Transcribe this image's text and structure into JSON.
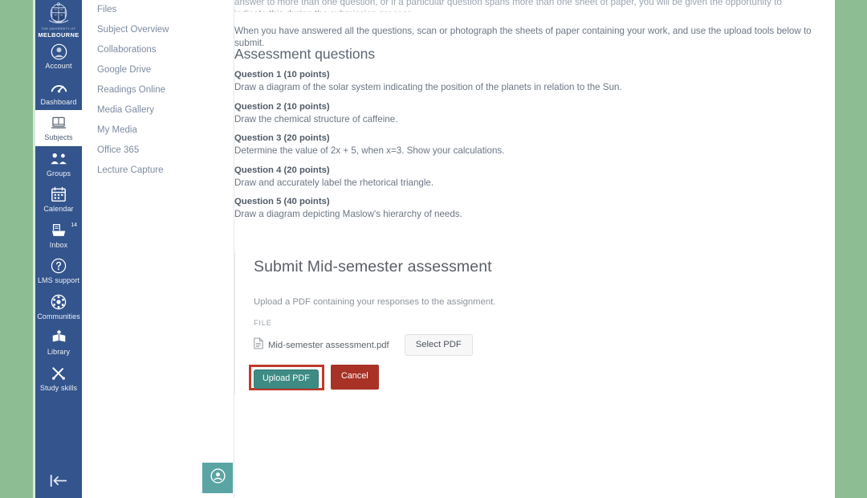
{
  "colors": {
    "page_band": "#8cbd93",
    "global_nav_bg": "#33548c",
    "accent_teal": "#3e8b84",
    "cancel_red": "#a93226",
    "highlight_red": "#c0392b",
    "fab_teal": "#5ba4a4"
  },
  "global_nav": {
    "logo": {
      "crest_icon": "university-crest-icon",
      "line1": "THE UNIVERSITY OF",
      "line2": "MELBOURNE"
    },
    "items": [
      {
        "label": "Account",
        "icon": "account-avatar-icon",
        "active": false,
        "badge": ""
      },
      {
        "label": "Dashboard",
        "icon": "dashboard-icon",
        "active": false,
        "badge": ""
      },
      {
        "label": "Subjects",
        "icon": "subjects-book-icon",
        "active": true,
        "badge": ""
      },
      {
        "label": "Groups",
        "icon": "groups-people-icon",
        "active": false,
        "badge": ""
      },
      {
        "label": "Calendar",
        "icon": "calendar-icon",
        "active": false,
        "badge": ""
      },
      {
        "label": "Inbox",
        "icon": "inbox-tray-icon",
        "active": false,
        "badge": "14"
      },
      {
        "label": "LMS support",
        "icon": "question-circle-icon",
        "active": false,
        "badge": ""
      },
      {
        "label": "Communities",
        "icon": "communities-globe-icon",
        "active": false,
        "badge": ""
      },
      {
        "label": "Library",
        "icon": "library-book-icon",
        "active": false,
        "badge": ""
      },
      {
        "label": "Study skills",
        "icon": "study-skills-icon",
        "active": false,
        "badge": ""
      }
    ],
    "collapse": {
      "icon": "collapse-left-arrow-icon",
      "label": ""
    }
  },
  "course_nav": {
    "items": [
      {
        "label": "Files"
      },
      {
        "label": "Subject Overview"
      },
      {
        "label": "Collaborations"
      },
      {
        "label": "Google Drive"
      },
      {
        "label": "Readings Online"
      },
      {
        "label": "Media Gallery"
      },
      {
        "label": "My Media"
      },
      {
        "label": "Office 365"
      },
      {
        "label": "Lecture Capture"
      }
    ],
    "help_fab": {
      "icon": "help-circle-icon"
    }
  },
  "content": {
    "intro_clipped": "answer to more than one question, or if a particular question spans more than one sheet of paper, you will be given the opportunity to indicate this during the submission process.",
    "paragraph_2": "When you have answered all the questions, scan or photograph the sheets of paper containing your work, and use the upload tools below to submit.",
    "assessment_heading": "Assessment questions",
    "questions": [
      {
        "title": "Question 1 (10 points)",
        "text": "Draw a diagram of the solar system indicating the position of the planets in relation to the Sun."
      },
      {
        "title": "Question 2 (10 points)",
        "text": "Draw the chemical structure of caffeine."
      },
      {
        "title": "Question 3 (20 points)",
        "text": "Determine the value of 2x + 5, when x=3. Show your calculations."
      },
      {
        "title": "Question 4 (20 points)",
        "text": "Draw and accurately label the rhetorical triangle."
      },
      {
        "title": "Question 5 (40 points)",
        "text": "Draw a diagram depicting Maslow's hierarchy of needs."
      }
    ]
  },
  "submit_widget": {
    "tools": [
      {
        "icon": "menu-expand-icon"
      },
      {
        "icon": "bar-chart-icon"
      },
      {
        "icon": "list-view-icon"
      },
      {
        "icon": "refresh-icon"
      }
    ],
    "title": "Submit Mid-semester assessment",
    "description": "Upload a PDF containing your responses to the assignment.",
    "file_label": "FILE",
    "file_icon": "pdf-document-icon",
    "file_name": "Mid-semester assessment.pdf",
    "select_button": "Select PDF",
    "upload_button": "Upload PDF",
    "cancel_button": "Cancel"
  }
}
